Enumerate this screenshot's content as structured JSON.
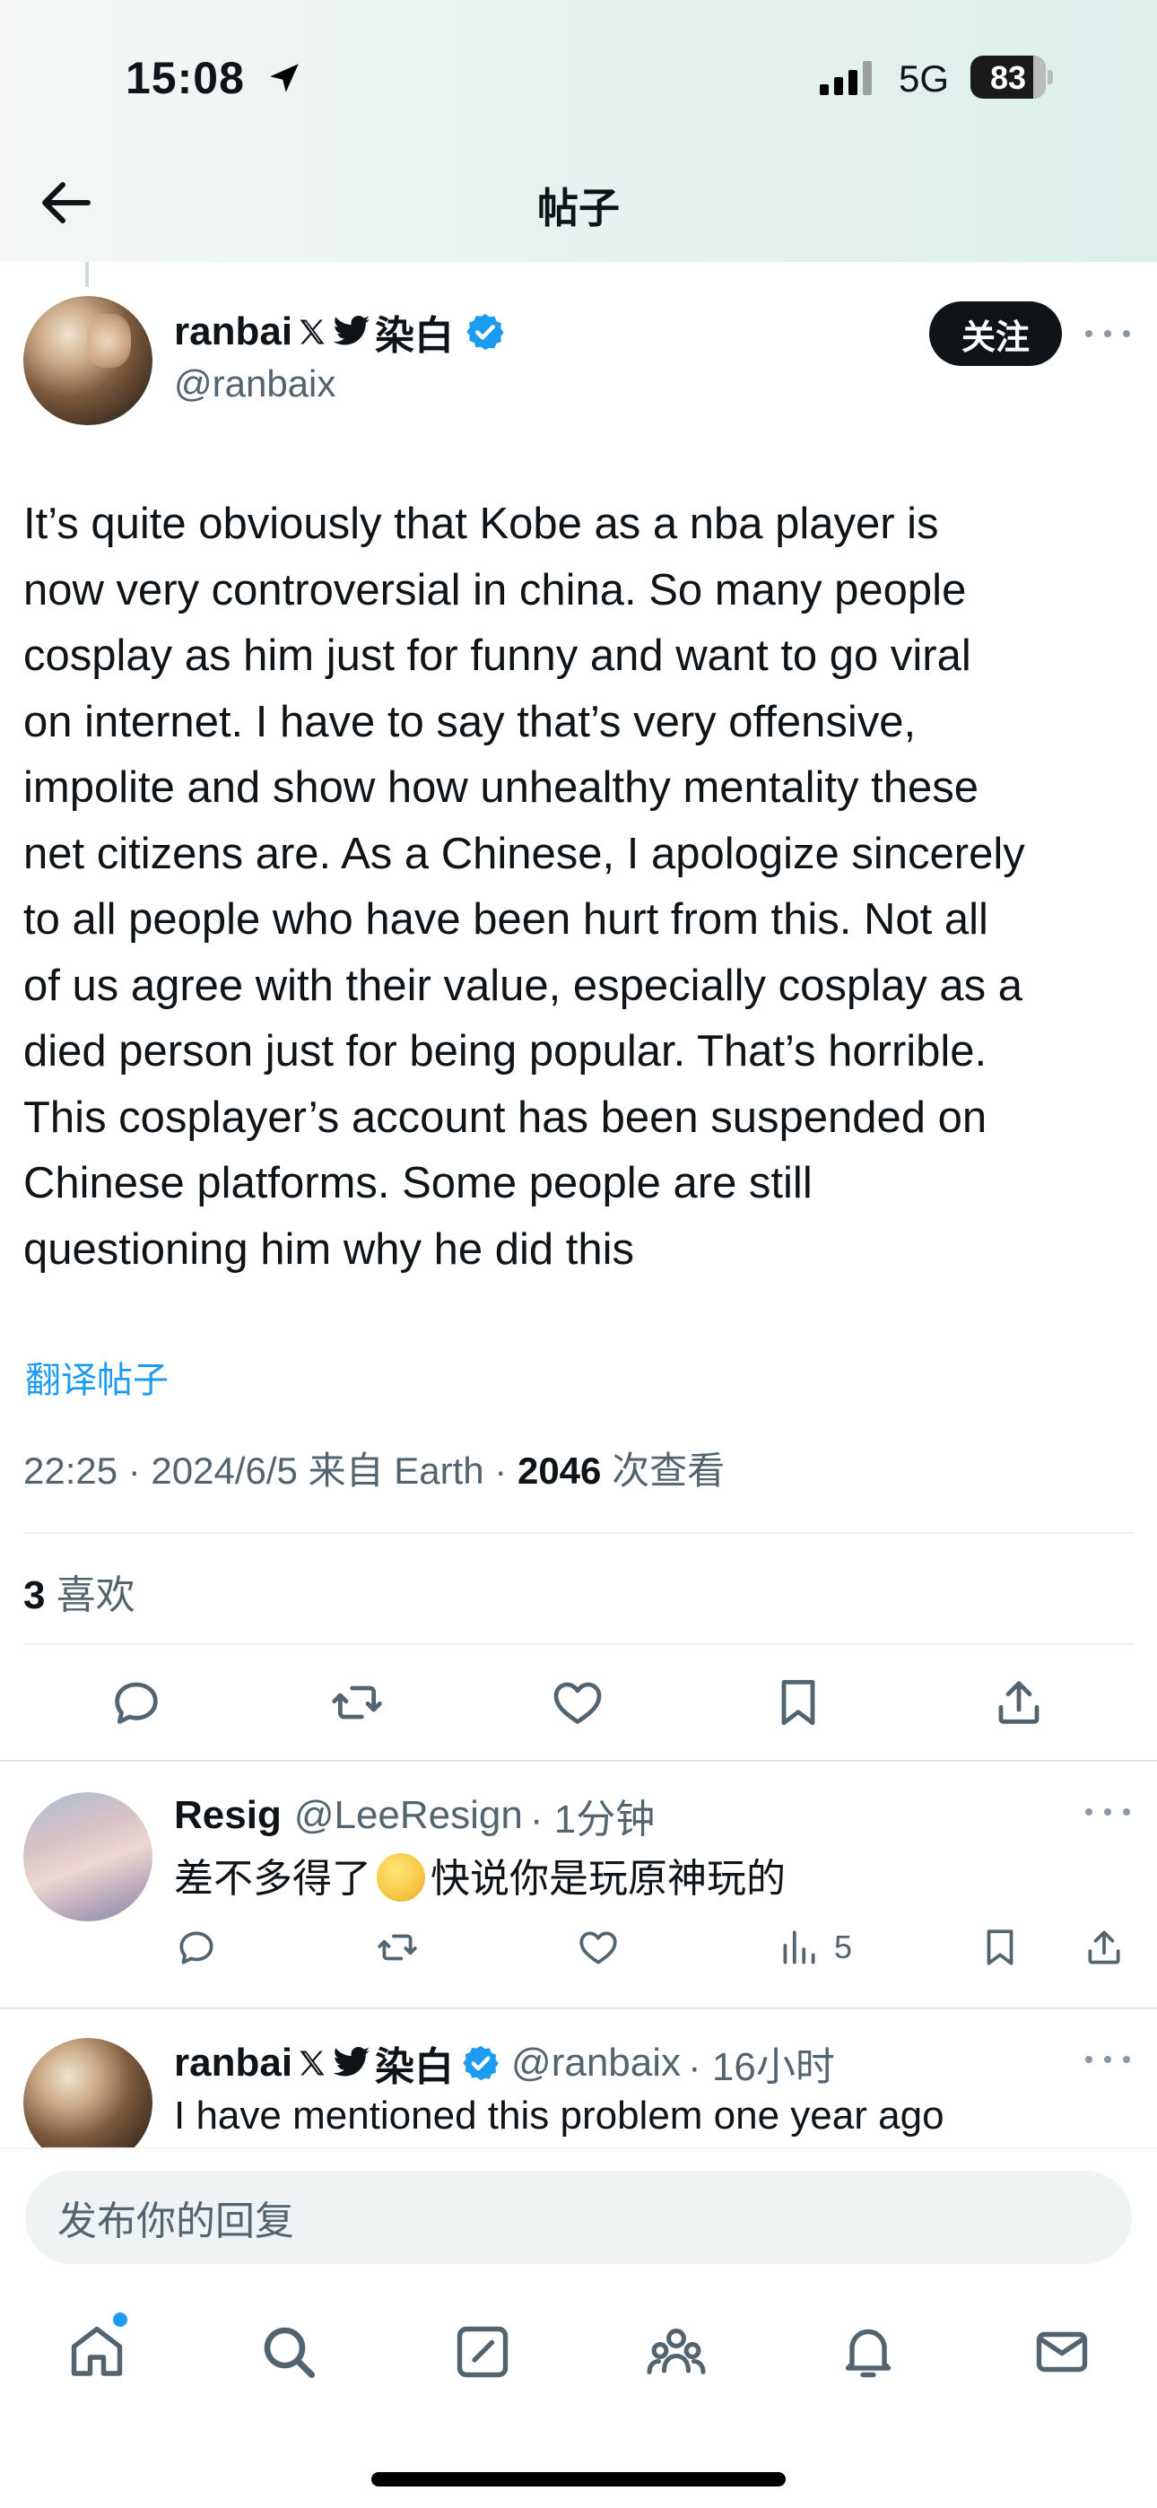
{
  "status_bar": {
    "time": "15:08",
    "network": "5G",
    "battery": "83",
    "battery_level": 0.83
  },
  "header": {
    "title": "帖子"
  },
  "post": {
    "author_name": "ranbai",
    "author_name_cjk": "染白",
    "handle": "@ranbaix",
    "follow_label": "关注",
    "body": "It’s quite obviously that Kobe as a nba player is\nnow very controversial in china. So many people\ncosplay as him just for funny and want to go viral\non internet. I have to say that’s very offensive,\nimpolite and show how unhealthy mentality these\nnet citizens are. As a Chinese, I apologize sincerely\nto all people who have been hurt from this. Not all\nof us agree with their  value, especially cosplay as a\ndied person just for being popular. That’s horrible.\nThis cosplayer’s account has been suspended on\nChinese platforms. Some people are still\nquestioning him why he did this",
    "translate_label": "翻译帖子",
    "meta_prefix": "22:25 · 2024/6/5 来自 Earth · ",
    "views_count": "2046",
    "views_label": " 次查看",
    "likes_count": "3",
    "likes_label": " 喜欢"
  },
  "replies": [
    {
      "name": "Resig",
      "handle": "@LeeResign",
      "time": "· 1分钟",
      "text_before": "差不多得了",
      "text_after": "快说你是玩原神玩的",
      "views": "5"
    },
    {
      "name": "ranbai",
      "name_cjk": "染白",
      "handle": "@ranbaix",
      "time": "· 16小时",
      "text": "I have mentioned this problem one year ago"
    }
  ],
  "composer": {
    "placeholder": "发布你的回复"
  },
  "tab_bar": {
    "items": [
      "home-icon",
      "search-icon",
      "compose-icon",
      "communities-icon",
      "notifications-icon",
      "messages-icon"
    ]
  },
  "colors": {
    "accent": "#1d9bf0",
    "text_primary": "#0f1419",
    "text_secondary": "#536471"
  }
}
